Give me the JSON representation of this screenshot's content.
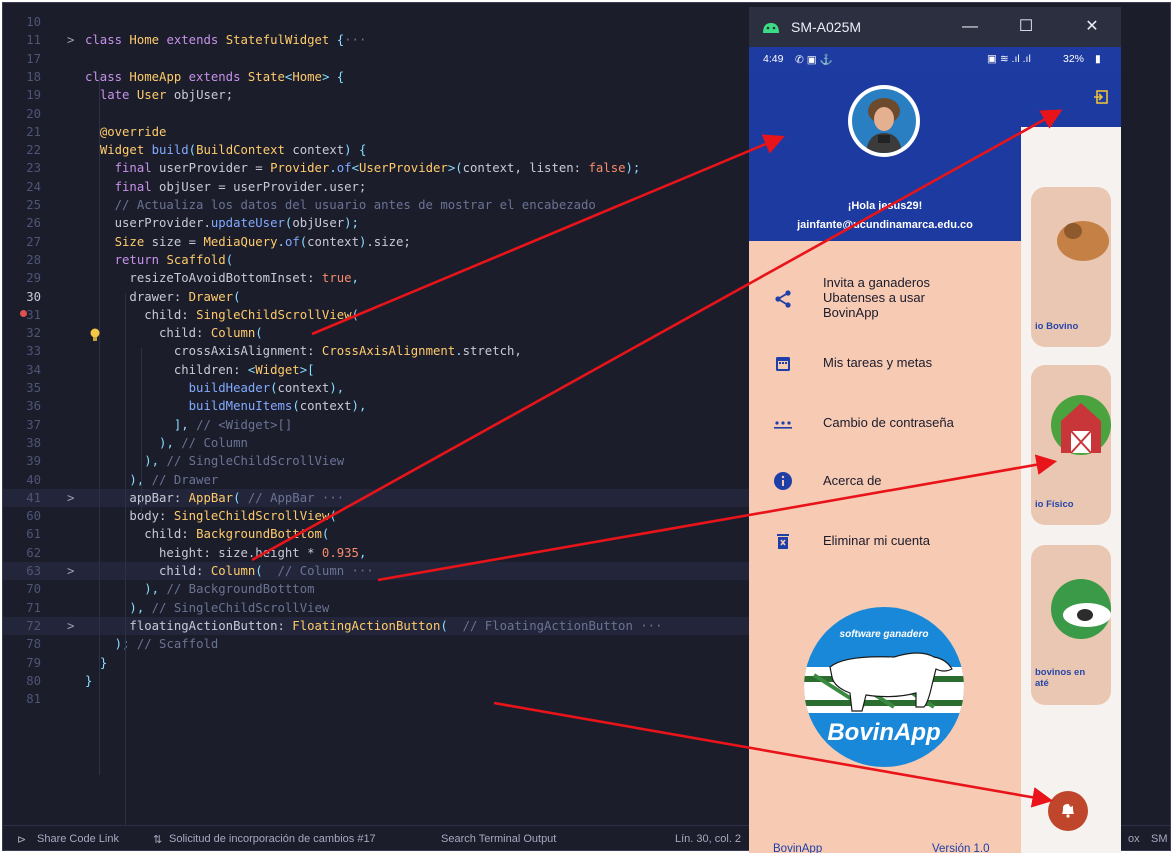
{
  "editor": {
    "lines": [
      {
        "n": "10",
        "tokens": []
      },
      {
        "n": "11",
        "fold": ">",
        "tokens": [
          [
            "k",
            "class "
          ],
          [
            "t",
            "Home "
          ],
          [
            "k",
            "extends "
          ],
          [
            "t",
            "StatefulWidget "
          ],
          [
            "p",
            "{"
          ],
          [
            "c",
            "···"
          ]
        ]
      },
      {
        "n": "17",
        "tokens": []
      },
      {
        "n": "18",
        "tokens": [
          [
            "k",
            "class "
          ],
          [
            "t",
            "HomeApp "
          ],
          [
            "k",
            "extends "
          ],
          [
            "t",
            "State"
          ],
          [
            "p",
            "<"
          ],
          [
            "t",
            "Home"
          ],
          [
            "p",
            "> {"
          ]
        ]
      },
      {
        "n": "19",
        "tokens": [
          [
            "v",
            "  "
          ],
          [
            "k",
            "late "
          ],
          [
            "t",
            "User "
          ],
          [
            "v",
            "objUser;"
          ]
        ]
      },
      {
        "n": "20",
        "tokens": []
      },
      {
        "n": "21",
        "tokens": [
          [
            "v",
            "  "
          ],
          [
            "an",
            "@override"
          ]
        ]
      },
      {
        "n": "22",
        "tokens": [
          [
            "v",
            "  "
          ],
          [
            "t",
            "Widget "
          ],
          [
            "f",
            "build"
          ],
          [
            "p",
            "("
          ],
          [
            "t",
            "BuildContext "
          ],
          [
            "v",
            "context"
          ],
          [
            "p",
            ") {"
          ]
        ]
      },
      {
        "n": "23",
        "tokens": [
          [
            "v",
            "    "
          ],
          [
            "k",
            "final "
          ],
          [
            "v",
            "userProvider = "
          ],
          [
            "t",
            "Provider"
          ],
          [
            "p",
            "."
          ],
          [
            "f",
            "of"
          ],
          [
            "p",
            "<"
          ],
          [
            "t",
            "UserProvider"
          ],
          [
            "p",
            ">("
          ],
          [
            "v",
            "context, listen: "
          ],
          [
            "a",
            "false"
          ],
          [
            "p",
            ");"
          ]
        ]
      },
      {
        "n": "24",
        "tokens": [
          [
            "v",
            "    "
          ],
          [
            "k",
            "final "
          ],
          [
            "v",
            "objUser = userProvider.user;"
          ]
        ]
      },
      {
        "n": "25",
        "tokens": [
          [
            "c",
            "    // Actualiza los datos del usuario antes de mostrar el encabezado"
          ]
        ]
      },
      {
        "n": "26",
        "tokens": [
          [
            "v",
            "    userProvider."
          ],
          [
            "f",
            "updateUser"
          ],
          [
            "p",
            "("
          ],
          [
            "v",
            "objUser"
          ],
          [
            "p",
            ");"
          ]
        ]
      },
      {
        "n": "27",
        "tokens": [
          [
            "v",
            "    "
          ],
          [
            "t",
            "Size "
          ],
          [
            "v",
            "size = "
          ],
          [
            "t",
            "MediaQuery"
          ],
          [
            "p",
            "."
          ],
          [
            "f",
            "of"
          ],
          [
            "p",
            "("
          ],
          [
            "v",
            "context"
          ],
          [
            "p",
            ")"
          ],
          [
            "v",
            ".size;"
          ]
        ]
      },
      {
        "n": "28",
        "tokens": [
          [
            "v",
            "    "
          ],
          [
            "k",
            "return "
          ],
          [
            "t",
            "Scaffold"
          ],
          [
            "p",
            "("
          ]
        ]
      },
      {
        "n": "29",
        "tokens": [
          [
            "v",
            "      resizeToAvoidBottomInset: "
          ],
          [
            "a",
            "true"
          ],
          [
            "p",
            ","
          ]
        ]
      },
      {
        "n": "30",
        "cur": true,
        "tokens": [
          [
            "v",
            "      drawer: "
          ],
          [
            "t",
            "Drawer"
          ],
          [
            "p",
            "("
          ]
        ]
      },
      {
        "n": "31",
        "tokens": [
          [
            "v",
            "        child: "
          ],
          [
            "t",
            "SingleChildScrollView"
          ],
          [
            "p",
            "("
          ]
        ]
      },
      {
        "n": "32",
        "tokens": [
          [
            "v",
            "          child: "
          ],
          [
            "t",
            "Column"
          ],
          [
            "p",
            "("
          ]
        ]
      },
      {
        "n": "33",
        "tokens": [
          [
            "v",
            "            crossAxisAlignment: "
          ],
          [
            "t",
            "CrossAxisAlignment"
          ],
          [
            "p",
            "."
          ],
          [
            "v",
            "stretch,"
          ]
        ]
      },
      {
        "n": "34",
        "tokens": [
          [
            "v",
            "            children: "
          ],
          [
            "p",
            "<"
          ],
          [
            "t",
            "Widget"
          ],
          [
            "p",
            ">["
          ]
        ]
      },
      {
        "n": "35",
        "tokens": [
          [
            "v",
            "              "
          ],
          [
            "f",
            "buildHeader"
          ],
          [
            "p",
            "("
          ],
          [
            "v",
            "context"
          ],
          [
            "p",
            "),"
          ]
        ]
      },
      {
        "n": "36",
        "tokens": [
          [
            "v",
            "              "
          ],
          [
            "f",
            "buildMenuItems"
          ],
          [
            "p",
            "("
          ],
          [
            "v",
            "context"
          ],
          [
            "p",
            "),"
          ]
        ]
      },
      {
        "n": "37",
        "tokens": [
          [
            "v",
            "            "
          ],
          [
            "p",
            "], "
          ],
          [
            "c",
            "// <Widget>[]"
          ]
        ]
      },
      {
        "n": "38",
        "tokens": [
          [
            "v",
            "          "
          ],
          [
            "p",
            "), "
          ],
          [
            "c",
            "// Column"
          ]
        ]
      },
      {
        "n": "39",
        "tokens": [
          [
            "v",
            "        "
          ],
          [
            "p",
            "), "
          ],
          [
            "c",
            "// SingleChildScrollView"
          ]
        ]
      },
      {
        "n": "40",
        "tokens": [
          [
            "v",
            "      "
          ],
          [
            "p",
            "), "
          ],
          [
            "c",
            "// Drawer"
          ]
        ]
      },
      {
        "n": "41",
        "fold": ">",
        "hl": true,
        "tokens": [
          [
            "v",
            "      appBar: "
          ],
          [
            "t",
            "AppBar"
          ],
          [
            "p",
            "( "
          ],
          [
            "c",
            "// AppBar ···"
          ]
        ]
      },
      {
        "n": "60",
        "tokens": [
          [
            "v",
            "      body: "
          ],
          [
            "t",
            "SingleChildScrollView"
          ],
          [
            "p",
            "("
          ]
        ]
      },
      {
        "n": "61",
        "tokens": [
          [
            "v",
            "        child: "
          ],
          [
            "t",
            "BackgroundBotttom"
          ],
          [
            "p",
            "("
          ]
        ]
      },
      {
        "n": "62",
        "tokens": [
          [
            "v",
            "          height: size.height * "
          ],
          [
            "a",
            "0.935"
          ],
          [
            "p",
            ","
          ]
        ]
      },
      {
        "n": "63",
        "fold": ">",
        "hl": true,
        "tokens": [
          [
            "v",
            "          child: "
          ],
          [
            "t",
            "Column"
          ],
          [
            "p",
            "( "
          ],
          [
            "c",
            " // Column ···"
          ]
        ]
      },
      {
        "n": "70",
        "tokens": [
          [
            "v",
            "        "
          ],
          [
            "p",
            "), "
          ],
          [
            "c",
            "// BackgroundBotttom"
          ]
        ]
      },
      {
        "n": "71",
        "tokens": [
          [
            "v",
            "      "
          ],
          [
            "p",
            "), "
          ],
          [
            "c",
            "// SingleChildScrollView"
          ]
        ]
      },
      {
        "n": "72",
        "fold": ">",
        "hl": true,
        "tokens": [
          [
            "v",
            "      floatingActionButton: "
          ],
          [
            "t",
            "FloatingActionButton"
          ],
          [
            "p",
            "( "
          ],
          [
            "c",
            " // FloatingActionButton ···"
          ]
        ]
      },
      {
        "n": "78",
        "tokens": [
          [
            "v",
            "    "
          ],
          [
            "p",
            "); "
          ],
          [
            "c",
            "// Scaffold"
          ]
        ]
      },
      {
        "n": "79",
        "tokens": [
          [
            "v",
            "  "
          ],
          [
            "p",
            "}"
          ]
        ]
      },
      {
        "n": "80",
        "tokens": [
          [
            "p",
            "}"
          ]
        ]
      },
      {
        "n": "81",
        "tokens": []
      }
    ]
  },
  "statusbar": {
    "share": "Share Code Link",
    "pr": "Solicitud de incorporación de cambios #17",
    "terminal": "Search Terminal Output",
    "position": "Lín. 30, col. 2",
    "right1": "ox",
    "right2": "SM"
  },
  "emulator": {
    "title": "SM-A025M",
    "minimize": "—",
    "maximize": "☐",
    "close": "✕",
    "time": "4:49",
    "battery": "32%",
    "drawer": {
      "greeting": "¡Hola jesus29!",
      "email": "jainfante@ucundinamarca.edu.co",
      "menu": [
        {
          "icon": "share-icon",
          "label": "Invita a ganaderos\nUbatenses a usar\nBovinApp"
        },
        {
          "icon": "calendar-icon",
          "label": "Mis tareas y metas"
        },
        {
          "icon": "password-icon",
          "label": "Cambio de contraseña"
        },
        {
          "icon": "info-icon",
          "label": "Acerca de"
        },
        {
          "icon": "trash-icon",
          "label": "Eliminar mi cuenta"
        }
      ],
      "logo_top": "software ganadero",
      "logo_bottom": "BovinApp",
      "footer_left": "BovinApp",
      "footer_right": "Versión 1.0"
    },
    "body_tiles": [
      "io Bovino",
      "io Físico",
      "bovinos en\naté"
    ]
  },
  "colors": {
    "arrow": "#e8141a",
    "header": "#1c3a9f",
    "drawer_bg": "#f7cab3",
    "fab": "#c0462b"
  }
}
